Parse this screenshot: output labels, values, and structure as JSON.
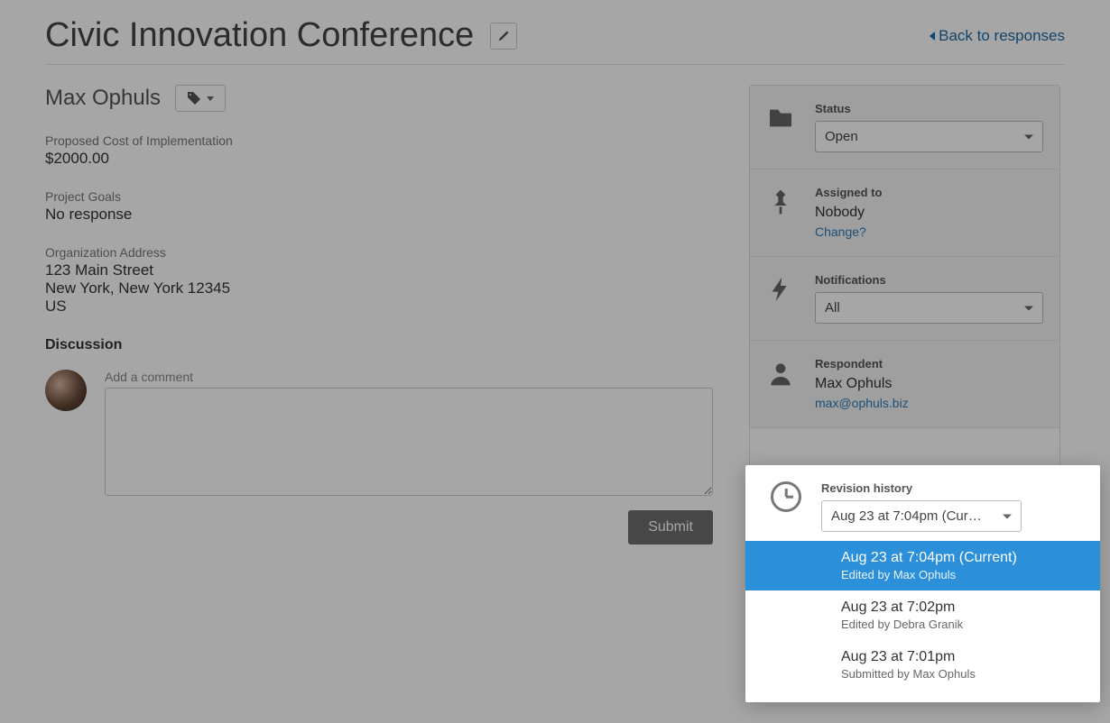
{
  "header": {
    "title": "Civic Innovation Conference",
    "back_label": "Back to responses"
  },
  "respondent_header": {
    "name": "Max Ophuls"
  },
  "fields": [
    {
      "label": "Proposed Cost of Implementation",
      "value": "$2000.00"
    },
    {
      "label": "Project Goals",
      "value": "No response"
    },
    {
      "label": "Organization Address",
      "value": "123 Main Street\nNew York, New York 12345\nUS"
    }
  ],
  "discussion": {
    "heading": "Discussion",
    "add_comment_label": "Add a comment",
    "submit_label": "Submit"
  },
  "sidebar": {
    "status": {
      "label": "Status",
      "value": "Open"
    },
    "assigned": {
      "label": "Assigned to",
      "value": "Nobody",
      "change_label": "Change?"
    },
    "notifications": {
      "label": "Notifications",
      "value": "All"
    },
    "respondent": {
      "label": "Respondent",
      "name": "Max Ophuls",
      "email": "max@ophuls.biz"
    },
    "revision": {
      "label": "Revision history",
      "selected": "Aug 23 at 7:04pm (Cur…",
      "items": [
        {
          "time": "Aug 23 at 7:04pm (Current)",
          "by": "Edited by Max Ophuls",
          "selected": true
        },
        {
          "time": "Aug 23 at 7:02pm",
          "by": "Edited by Debra Granik",
          "selected": false
        },
        {
          "time": "Aug 23 at 7:01pm",
          "by": "Submitted by Max Ophuls",
          "selected": false
        }
      ]
    }
  }
}
